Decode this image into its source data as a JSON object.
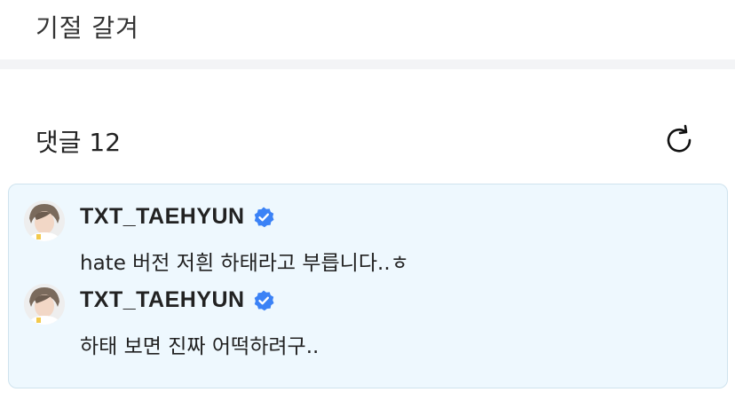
{
  "post": {
    "text": "기절 갈겨"
  },
  "comments_section": {
    "title": "댓글 12",
    "refresh_icon": "refresh-icon"
  },
  "artist_comments": [
    {
      "author": "TXT_TAEHYUN",
      "verified": true,
      "text": "hate 버전 저흰 하태라고 부릅니다..ㅎ"
    },
    {
      "author": "TXT_TAEHYUN",
      "verified": true,
      "text": "하태 보면 진짜 어떡하려구.."
    }
  ],
  "colors": {
    "box_bg": "#eef8fe",
    "box_border": "#cfe3ee",
    "verified_blue": "#3b82f6"
  }
}
